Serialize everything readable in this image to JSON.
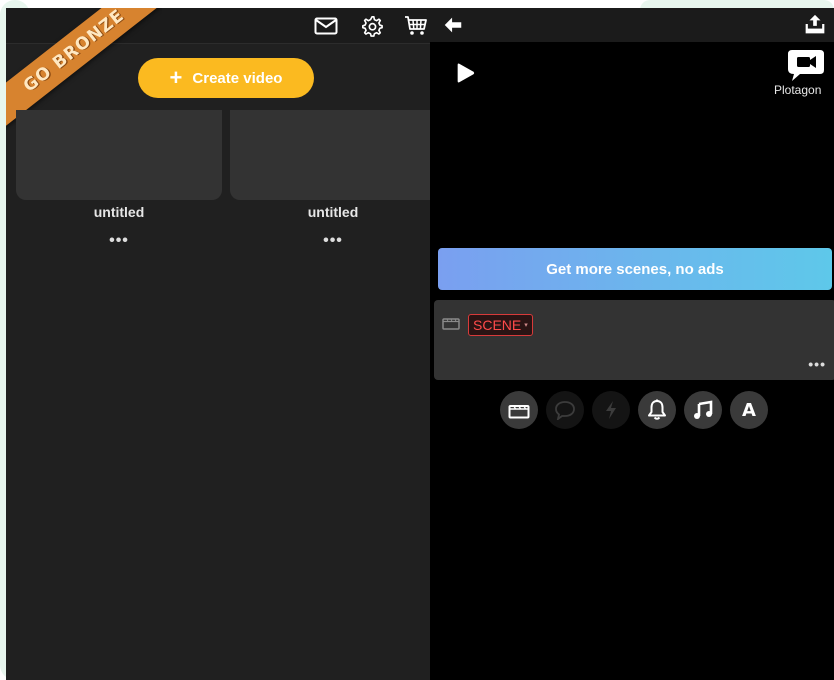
{
  "left_panel": {
    "banner": {
      "label": "GO BRONZE",
      "color": "#d7832f"
    },
    "topbar": {
      "icons": [
        "mail-icon",
        "gear-icon",
        "cart-icon"
      ]
    },
    "create_button": {
      "plus": "+",
      "label": "Create video",
      "color": "#fbba20"
    },
    "videos": [
      {
        "title": "untitled",
        "more": "•••"
      },
      {
        "title": "untitled",
        "more": "•••"
      }
    ]
  },
  "right_panel": {
    "topbar": {
      "icons": [
        "back-arrow-icon",
        "share-icon"
      ]
    },
    "player": {
      "play_icon": "play-icon"
    },
    "logo": {
      "text": "Plotagon"
    },
    "upgrade_button": {
      "label": "Get more scenes, no ads"
    },
    "scene_item": {
      "label": "SCENE",
      "caret": "▾",
      "more": "•••",
      "accent": "#d83a3a"
    },
    "toolbar": {
      "buttons": [
        "clapper-icon",
        "speech-bubble-icon",
        "lightning-icon",
        "bell-icon",
        "music-note-icon",
        "text-icon"
      ],
      "text_glyph": "A"
    }
  }
}
